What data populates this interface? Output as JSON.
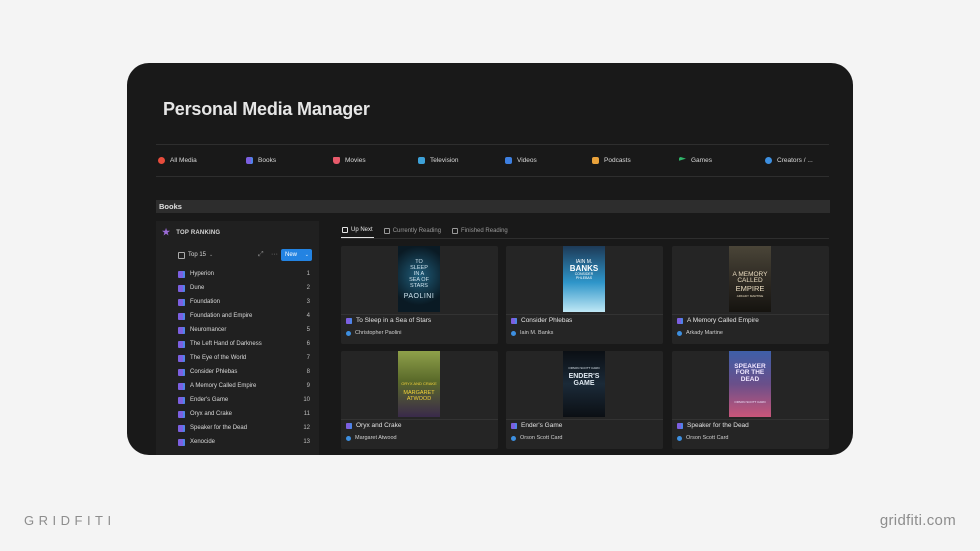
{
  "page": {
    "title": "Personal Media Manager"
  },
  "nav": [
    {
      "label": "All Media",
      "icon": "all-media-icon",
      "color": "#e74c3c"
    },
    {
      "label": "Books",
      "icon": "books-icon",
      "color": "#7c5fe0"
    },
    {
      "label": "Movies",
      "icon": "popcorn-icon",
      "color": "#e85a6b"
    },
    {
      "label": "Television",
      "icon": "television-icon",
      "color": "#3da1d8"
    },
    {
      "label": "Videos",
      "icon": "videos-icon",
      "color": "#3d7fe0"
    },
    {
      "label": "Podcasts",
      "icon": "podcasts-icon",
      "color": "#e9a23b"
    },
    {
      "label": "Games",
      "icon": "games-icon",
      "color": "#2fb56a"
    },
    {
      "label": "Creators / ...",
      "icon": "creators-icon",
      "color": "#3d8fe0"
    }
  ],
  "section": {
    "title": "Books"
  },
  "sidebar": {
    "heading": "TOP RANKING",
    "view": "Top 15",
    "more": "···",
    "new_label": "New",
    "items": [
      {
        "title": "Hyperion",
        "rank": "1"
      },
      {
        "title": "Dune",
        "rank": "2"
      },
      {
        "title": "Foundation",
        "rank": "3"
      },
      {
        "title": "Foundation and Empire",
        "rank": "4"
      },
      {
        "title": "Neuromancer",
        "rank": "5"
      },
      {
        "title": "The Left Hand of Darkness",
        "rank": "6"
      },
      {
        "title": "The Eye of the World",
        "rank": "7"
      },
      {
        "title": "Consider Phlebas",
        "rank": "8"
      },
      {
        "title": "A Memory Called Empire",
        "rank": "9"
      },
      {
        "title": "Ender's Game",
        "rank": "10"
      },
      {
        "title": "Oryx and Crake",
        "rank": "11"
      },
      {
        "title": "Speaker for the Dead",
        "rank": "12"
      },
      {
        "title": "Xenocide",
        "rank": "13"
      }
    ]
  },
  "tabs": [
    {
      "label": "Up Next",
      "active": true
    },
    {
      "label": "Currently Reading",
      "active": false
    },
    {
      "label": "Finished Reading",
      "active": false
    }
  ],
  "cards": [
    {
      "title": "To Sleep in a Sea of Stars",
      "author": "Christopher Paolini",
      "cover": {
        "lines": [
          "TO",
          "SLEEP",
          "IN A",
          "SEA OF",
          "STARS"
        ],
        "foot": "PAOLINI",
        "bg": "#0d2230",
        "fg": "#cfe3ee"
      }
    },
    {
      "title": "Consider Phlebas",
      "author": "Iain M. Banks",
      "cover": {
        "lines": [
          "IAIN M.",
          "BANKS",
          "CONSIDER",
          "PHLEBAS"
        ],
        "foot": "",
        "bg": "#2e95c9",
        "fg": "#ffffff"
      }
    },
    {
      "title": "A Memory Called Empire",
      "author": "Arkady Martine",
      "cover": {
        "lines": [
          "A MEMORY",
          "CALLED",
          "EMPIRE"
        ],
        "foot": "ARKADY MARTINE",
        "bg": "#2a2620",
        "fg": "#e9dcc0"
      }
    },
    {
      "title": "Oryx and Crake",
      "author": "Margaret Atwood",
      "cover": {
        "lines": [
          "ORYX AND CRAKE"
        ],
        "foot": "MARGARET ATWOOD",
        "bg": "#5a6a2a",
        "fg": "#f2d13a"
      }
    },
    {
      "title": "Ender's Game",
      "author": "Orson Scott Card",
      "cover": {
        "lines": [
          "ORSON SCOTT CARD",
          "ENDER'S",
          "GAME"
        ],
        "foot": "",
        "bg": "#141c24",
        "fg": "#dfe8f0"
      }
    },
    {
      "title": "Speaker for the Dead",
      "author": "Orson Scott Card",
      "cover": {
        "lines": [
          "SPEAKER",
          "FOR THE",
          "DEAD"
        ],
        "foot": "ORSON SCOTT CARD",
        "bg": "#6a4f8a",
        "fg": "#f1e6ff"
      }
    }
  ],
  "branding": {
    "left": "GRIDFITI",
    "right": "gridfiti.com"
  }
}
